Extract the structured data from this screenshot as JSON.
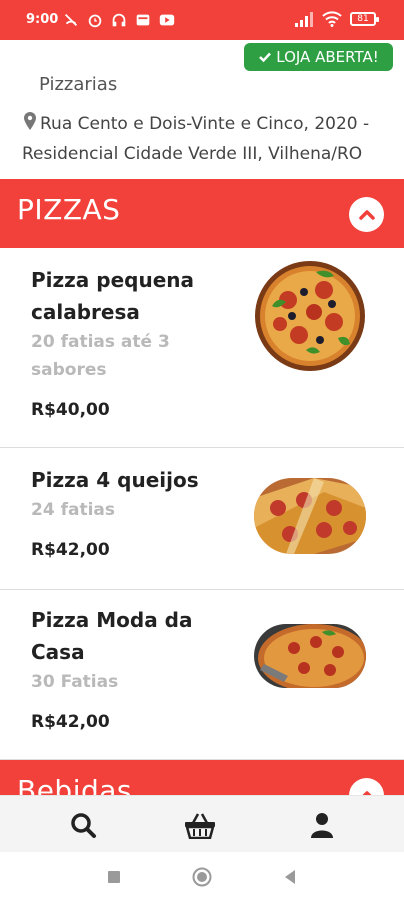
{
  "status_bar": {
    "time": "9:00",
    "battery": "81"
  },
  "store": {
    "open_badge": "LOJA ABERTA!",
    "category": "Pizzarias",
    "address": "Rua Cento e Dois-Vinte e Cinco, 2020 - Residencial Cidade Verde III, Vilhena/RO"
  },
  "sections": [
    {
      "title": "PIZZAS",
      "products": [
        {
          "name": "Pizza pequena calabresa",
          "description": "20 fatias até 3 sabores",
          "price": "R$40,00"
        },
        {
          "name": "Pizza 4 queijos",
          "description": "24 fatias",
          "price": "R$42,00"
        },
        {
          "name": "Pizza Moda da Casa",
          "description": "30 Fatias",
          "price": "R$42,00"
        }
      ]
    },
    {
      "title": "Bebidas"
    }
  ],
  "colors": {
    "primary": "#f2413a",
    "open_badge": "#2ea043",
    "muted_text": "#b9b9b9"
  },
  "icons": {
    "bottom_nav": [
      "search-icon",
      "basket-icon",
      "user-icon"
    ],
    "system_nav": [
      "recents-square-icon",
      "home-circle-icon",
      "back-triangle-icon"
    ]
  }
}
